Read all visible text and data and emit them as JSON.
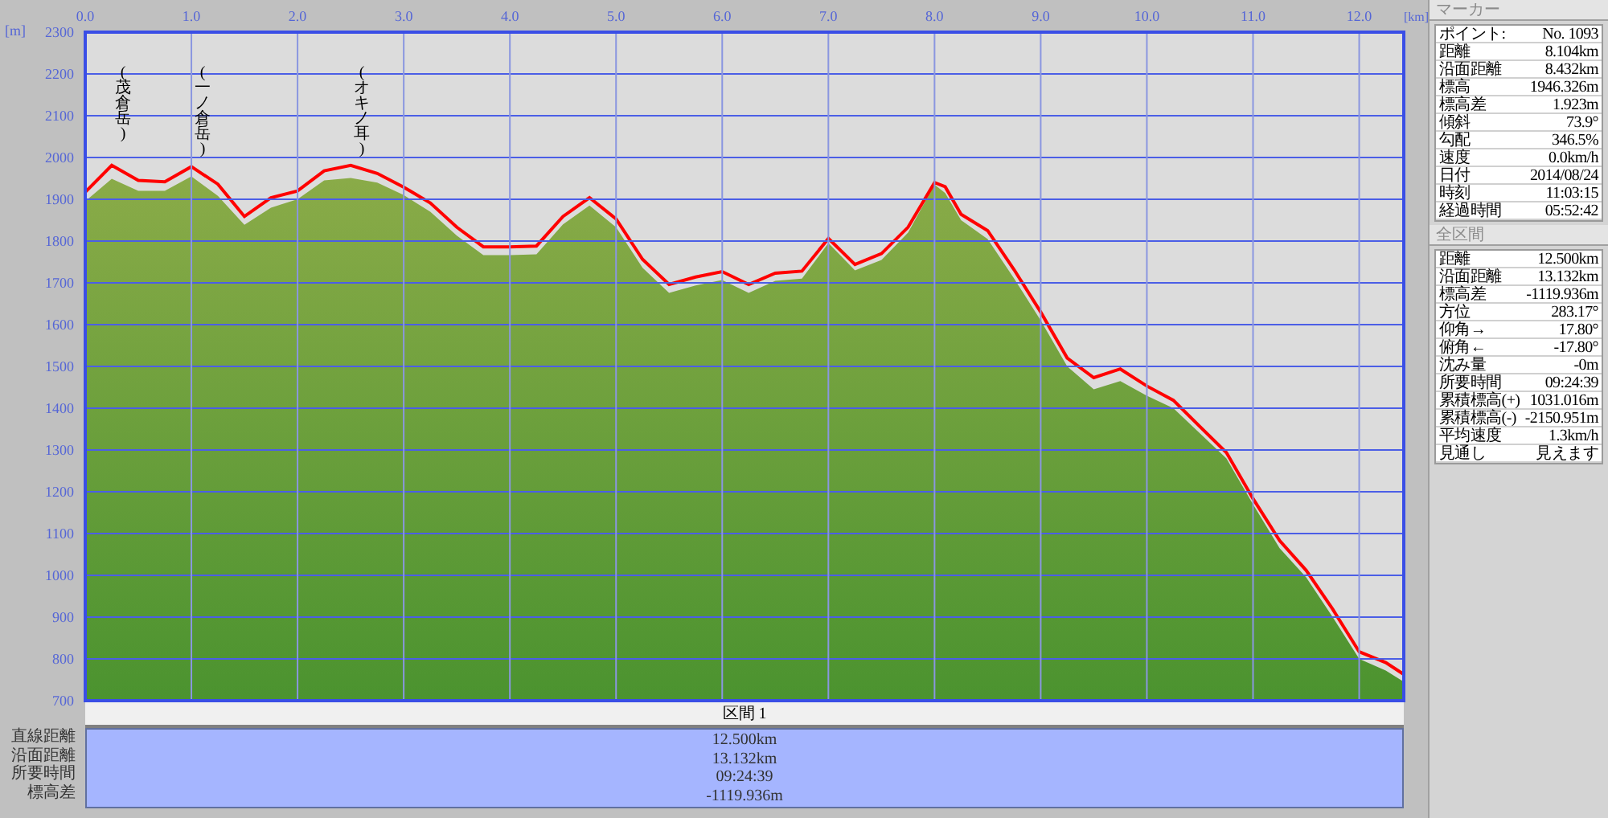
{
  "profile": {
    "chart_data": {
      "type": "area",
      "xlabel": "[km]",
      "ylabel": "[m]",
      "x": [
        0,
        0.25,
        0.5,
        0.75,
        1.0,
        1.25,
        1.5,
        1.75,
        2.0,
        2.25,
        2.5,
        2.75,
        3.0,
        3.25,
        3.5,
        3.75,
        4.0,
        4.25,
        4.5,
        4.75,
        5.0,
        5.25,
        5.5,
        5.75,
        6.0,
        6.25,
        6.5,
        6.75,
        7.0,
        7.25,
        7.5,
        7.75,
        8.0,
        8.1,
        8.25,
        8.5,
        8.75,
        9.0,
        9.25,
        9.5,
        9.75,
        10.0,
        10.25,
        10.5,
        10.75,
        11.0,
        11.25,
        11.5,
        11.75,
        12.0,
        12.25,
        12.42
      ],
      "series": [
        {
          "type": "area",
          "color": "#8aab48",
          "values": [
            1895,
            1949,
            1920,
            1920,
            1955,
            1908,
            1839,
            1880,
            1900,
            1945,
            1951,
            1940,
            1910,
            1870,
            1813,
            1766,
            1766,
            1768,
            1840,
            1885,
            1833,
            1736,
            1676,
            1694,
            1707,
            1676,
            1705,
            1710,
            1795,
            1730,
            1755,
            1820,
            1935,
            1915,
            1850,
            1805,
            1710,
            1610,
            1500,
            1445,
            1465,
            1430,
            1400,
            1340,
            1280,
            1170,
            1065,
            995,
            900,
            800,
            772,
            745
          ]
        },
        {
          "type": "line",
          "color": "#ff0000",
          "values": [
            1917,
            1981,
            1945,
            1942,
            1978,
            1936,
            1859,
            1904,
            1920,
            1968,
            1981,
            1962,
            1929,
            1891,
            1833,
            1786,
            1786,
            1788,
            1859,
            1904,
            1853,
            1756,
            1696,
            1714,
            1727,
            1696,
            1723,
            1728,
            1806,
            1744,
            1770,
            1833,
            1940,
            1930,
            1864,
            1825,
            1731,
            1630,
            1520,
            1473,
            1494,
            1453,
            1419,
            1356,
            1294,
            1184,
            1083,
            1012,
            919,
            817,
            791,
            763
          ]
        }
      ],
      "grid": true,
      "xlim": [
        0,
        12.42
      ],
      "ylim": [
        700,
        2300
      ],
      "xticks": [
        {
          "value": 0,
          "label": "0.0"
        },
        {
          "value": 1,
          "label": "1.0"
        },
        {
          "value": 2,
          "label": "2.0"
        },
        {
          "value": 3,
          "label": "3.0"
        },
        {
          "value": 4,
          "label": "4.0"
        },
        {
          "value": 5,
          "label": "5.0"
        },
        {
          "value": 6,
          "label": "6.0"
        },
        {
          "value": 7,
          "label": "7.0"
        },
        {
          "value": 8,
          "label": "8.0"
        },
        {
          "value": 9,
          "label": "9.0"
        },
        {
          "value": 10,
          "label": "10.0"
        },
        {
          "value": 11,
          "label": "11.0"
        },
        {
          "value": 12,
          "label": "12.0"
        }
      ],
      "yticks": [
        700,
        800,
        900,
        1000,
        1100,
        1200,
        1300,
        1400,
        1500,
        1600,
        1700,
        1800,
        1900,
        2000,
        2100,
        2200,
        2300
      ],
      "annotations": [
        "(茂倉岳)",
        "(一ノ倉岳)",
        "(オキノ耳)"
      ]
    }
  },
  "section_table": {
    "header": "区間 1",
    "rows": [
      {
        "label": "直線距離",
        "value": "12.500km"
      },
      {
        "label": "沿面距離",
        "value": "13.132km"
      },
      {
        "label": "所要時間",
        "value": "09:24:39"
      },
      {
        "label": "標高差",
        "value": "-1119.936m"
      }
    ]
  },
  "side_panel": [
    {
      "title": "マーカー",
      "rows": [
        {
          "label": "ポイント:",
          "value": "No. 1093"
        },
        {
          "label": "距離",
          "value": "8.104km"
        },
        {
          "label": "沿面距離",
          "value": "8.432km"
        },
        {
          "label": "標高",
          "value": "1946.326m"
        },
        {
          "label": "標高差",
          "value": "1.923m"
        },
        {
          "label": "傾斜",
          "value": "73.9°"
        },
        {
          "label": "勾配",
          "value": "346.5%"
        },
        {
          "label": "速度",
          "value": "0.0km/h"
        },
        {
          "label": "日付",
          "value": "2014/08/24"
        },
        {
          "label": "時刻",
          "value": "11:03:15"
        },
        {
          "label": "経過時間",
          "value": "05:52:42"
        }
      ]
    },
    {
      "title": "全区間",
      "rows": [
        {
          "label": "距離",
          "value": "12.500km"
        },
        {
          "label": "沿面距離",
          "value": "13.132km"
        },
        {
          "label": "標高差",
          "value": "-1119.936m"
        },
        {
          "label": "方位",
          "value": "283.17°"
        },
        {
          "label": "仰角→",
          "value": "17.80°"
        },
        {
          "label": "俯角←",
          "value": "-17.80°"
        },
        {
          "label": "沈み量",
          "value": "-0m"
        },
        {
          "label": "所要時間",
          "value": "09:24:39"
        },
        {
          "label": "累積標高(+)",
          "value": "1031.016m"
        },
        {
          "label": "累積標高(-)",
          "value": "-2150.951m"
        },
        {
          "label": "平均速度",
          "value": "1.3km/h"
        },
        {
          "label": "見通し",
          "value": "見えます"
        }
      ]
    }
  ]
}
